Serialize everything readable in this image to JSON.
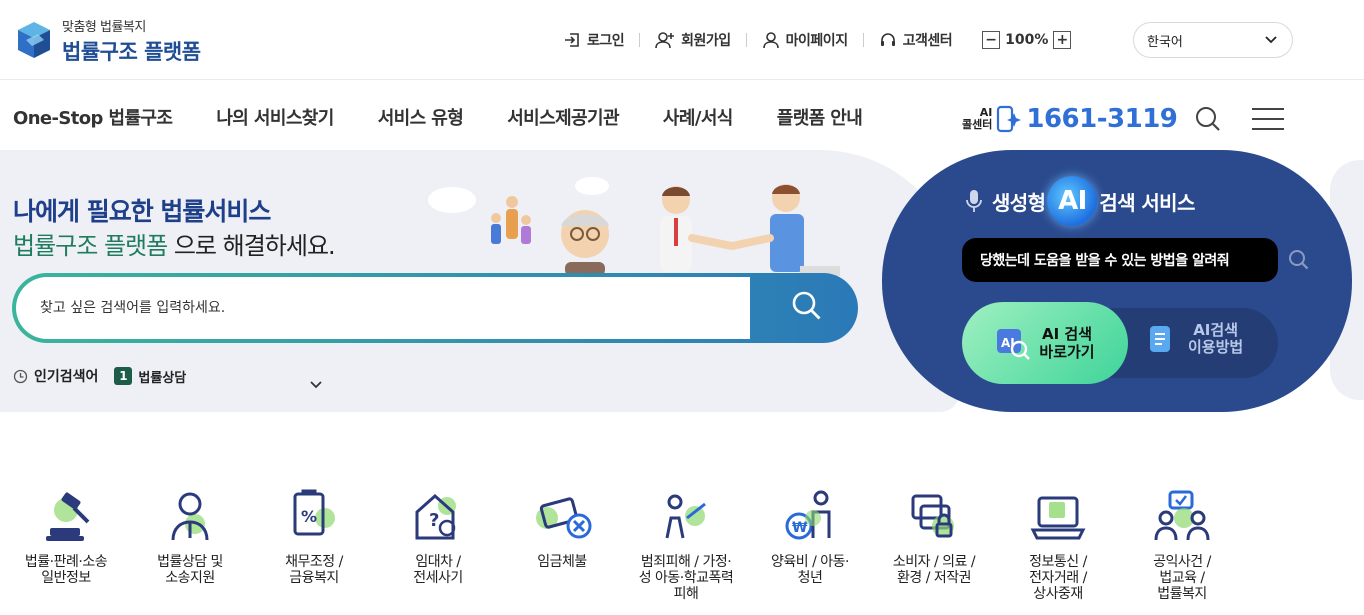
{
  "brand": {
    "subtitle": "맞춤형 법률복지",
    "title": "법률구조 플랫폼"
  },
  "utility": {
    "login": "로그인",
    "signup": "회원가입",
    "mypage": "마이페이지",
    "support": "고객센터",
    "zoom": "100%",
    "language": "한국어"
  },
  "nav": {
    "items": [
      {
        "label": "One-Stop 법률구조"
      },
      {
        "label": "나의 서비스찾기"
      },
      {
        "label": "서비스 유형"
      },
      {
        "label": "서비스제공기관"
      },
      {
        "label": "사례/서식"
      },
      {
        "label": "플랫폼 안내"
      }
    ],
    "callcenter_label": "AI\n콜센터",
    "phone": "1661-3119"
  },
  "hero": {
    "title_line1": "나에게 필요한 법률서비스",
    "title_line2_highlight": "법률구조 플랫폼",
    "title_line2_rest": " 으로 해결하세요.",
    "search_placeholder": "찾고 싶은 검색어를 입력하세요.",
    "popular_label": "인기검색어",
    "popular_rank": "1",
    "popular_term": "법률상담"
  },
  "ai": {
    "title_pre": "생성형",
    "title_orb": "AI",
    "title_post": "검색 서비스",
    "query": "당했는데 도움을 받을 수 있는 방법을 알려줘",
    "go_button": "AI 검색\n바로가기",
    "guide_button": "AI검색\n이용방법"
  },
  "categories": [
    {
      "label": "법률·판례·소송\n일반정보",
      "icon": "gavel-icon"
    },
    {
      "label": "법률상담 및\n소송지원",
      "icon": "lawyer-icon"
    },
    {
      "label": "채무조정 /\n금융복지",
      "icon": "debt-icon"
    },
    {
      "label": "임대차 /\n전세사기",
      "icon": "house-icon"
    },
    {
      "label": "임금체불",
      "icon": "wage-icon"
    },
    {
      "label": "범죄피해 / 가정·\n성 아동·학교폭력\n피해",
      "icon": "victim-icon"
    },
    {
      "label": "양육비 / 아동·\n청년",
      "icon": "family-icon"
    },
    {
      "label": "소비자 / 의료 /\n환경 / 저작권",
      "icon": "consumer-icon"
    },
    {
      "label": "정보통신 /\n전자거래 /\n상사중재",
      "icon": "laptop-icon"
    },
    {
      "label": "공익사건 /\n법교육 /\n법률복지",
      "icon": "public-icon"
    }
  ],
  "colors": {
    "brand": "#1f4e95",
    "accent_green": "#3bb59c",
    "ai_panel": "#2b4a8e",
    "phone": "#2f6fd6"
  }
}
